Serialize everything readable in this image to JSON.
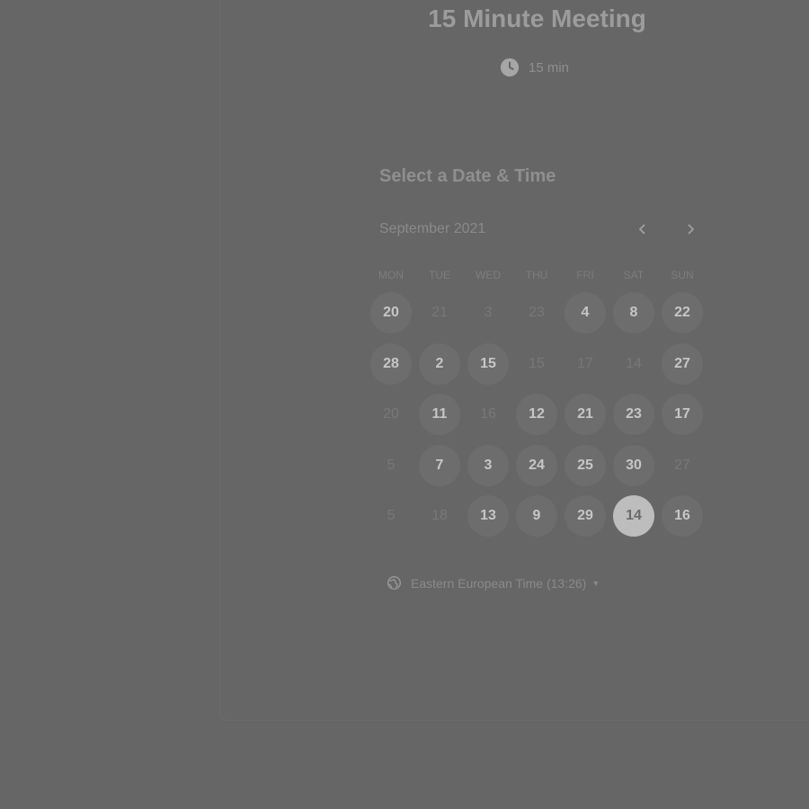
{
  "event": {
    "title": "15 Minute Meeting",
    "duration": "15 min",
    "duration_icon": "clock-icon"
  },
  "calendar": {
    "heading": "Select a Date & Time",
    "month_label": "September 2021",
    "prev_icon": "chevron-left-icon",
    "next_icon": "chevron-right-icon",
    "weekdays": [
      "MON",
      "TUE",
      "WED",
      "THU",
      "FRI",
      "SAT",
      "SUN"
    ],
    "days": [
      {
        "label": "20",
        "state": "available"
      },
      {
        "label": "21",
        "state": "unavailable"
      },
      {
        "label": "3",
        "state": "unavailable"
      },
      {
        "label": "23",
        "state": "unavailable"
      },
      {
        "label": "4",
        "state": "available"
      },
      {
        "label": "8",
        "state": "available"
      },
      {
        "label": "22",
        "state": "available"
      },
      {
        "label": "28",
        "state": "available"
      },
      {
        "label": "2",
        "state": "available"
      },
      {
        "label": "15",
        "state": "available"
      },
      {
        "label": "15",
        "state": "unavailable"
      },
      {
        "label": "17",
        "state": "unavailable"
      },
      {
        "label": "14",
        "state": "unavailable"
      },
      {
        "label": "27",
        "state": "available"
      },
      {
        "label": "20",
        "state": "unavailable"
      },
      {
        "label": "11",
        "state": "available"
      },
      {
        "label": "16",
        "state": "unavailable"
      },
      {
        "label": "12",
        "state": "available"
      },
      {
        "label": "21",
        "state": "available"
      },
      {
        "label": "23",
        "state": "available"
      },
      {
        "label": "17",
        "state": "available"
      },
      {
        "label": "5",
        "state": "unavailable"
      },
      {
        "label": "7",
        "state": "available"
      },
      {
        "label": "3",
        "state": "available"
      },
      {
        "label": "24",
        "state": "available"
      },
      {
        "label": "25",
        "state": "available"
      },
      {
        "label": "30",
        "state": "available"
      },
      {
        "label": "27",
        "state": "unavailable"
      },
      {
        "label": "5",
        "state": "unavailable"
      },
      {
        "label": "18",
        "state": "unavailable"
      },
      {
        "label": "13",
        "state": "available"
      },
      {
        "label": "9",
        "state": "available"
      },
      {
        "label": "29",
        "state": "available"
      },
      {
        "label": "14",
        "state": "selected"
      },
      {
        "label": "16",
        "state": "available"
      }
    ]
  },
  "timezone": {
    "label": "Eastern European Time (13:26)",
    "icon": "globe-icon"
  },
  "colors": {
    "overlay_background": "#666666",
    "available_day_bg": "#6d6d6d",
    "selected_day_bg": "#bdbdbd"
  }
}
